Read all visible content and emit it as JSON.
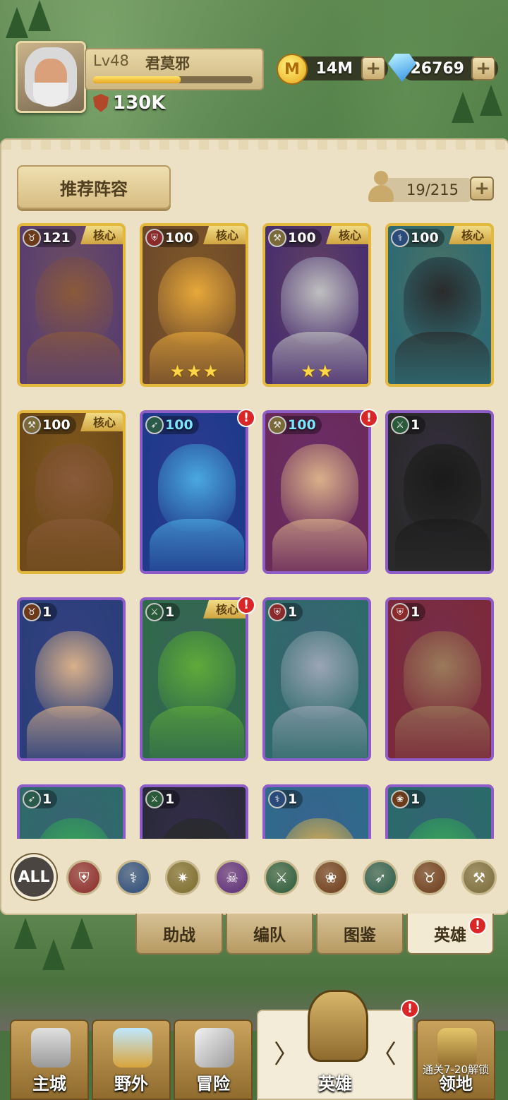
{
  "player": {
    "level": "Lv48",
    "name": "君莫邪",
    "xp_fraction": 0.55,
    "power": "130K"
  },
  "resources": {
    "gold": "14M",
    "gold_icon_glyph": "M",
    "gems": "26769"
  },
  "panel": {
    "recommend_button": "推荐阵容",
    "hero_count": "19/215"
  },
  "core_label": "核心",
  "heroes": [
    {
      "level": "121",
      "role": "ox-skull-icon",
      "core": true,
      "alert": false,
      "frame": "gold",
      "stars": 0
    },
    {
      "level": "100",
      "role": "shield-icon",
      "core": true,
      "alert": false,
      "frame": "gold",
      "stars": 3
    },
    {
      "level": "100",
      "role": "war-axe-icon",
      "core": true,
      "alert": false,
      "frame": "gold",
      "stars": 2
    },
    {
      "level": "100",
      "role": "staff-icon",
      "core": true,
      "alert": false,
      "frame": "gold",
      "stars": 0
    },
    {
      "level": "100",
      "role": "war-axe-icon",
      "core": true,
      "alert": false,
      "frame": "gold",
      "stars": 0
    },
    {
      "level": "100",
      "role": "bow-icon",
      "core": false,
      "alert": true,
      "frame": "purple",
      "stars": 0
    },
    {
      "level": "100",
      "role": "war-axe-icon",
      "core": false,
      "alert": true,
      "frame": "purple",
      "stars": 0
    },
    {
      "level": "1",
      "role": "crossed-blades-icon",
      "core": false,
      "alert": false,
      "frame": "purple",
      "stars": 0
    },
    {
      "level": "1",
      "role": "ox-skull-icon",
      "core": false,
      "alert": false,
      "frame": "purple",
      "stars": 0
    },
    {
      "level": "1",
      "role": "crossed-blades-icon",
      "core": true,
      "alert": true,
      "frame": "purple",
      "stars": 0
    },
    {
      "level": "1",
      "role": "shield-icon",
      "core": false,
      "alert": false,
      "frame": "purple",
      "stars": 0
    },
    {
      "level": "1",
      "role": "shield-icon",
      "core": false,
      "alert": false,
      "frame": "purple",
      "stars": 0
    },
    {
      "level": "1",
      "role": "bow-icon",
      "core": false,
      "alert": false,
      "frame": "purple",
      "stars": 0
    },
    {
      "level": "1",
      "role": "crossed-blades-icon",
      "core": false,
      "alert": false,
      "frame": "purple",
      "stars": 0
    },
    {
      "level": "1",
      "role": "staff-icon",
      "core": false,
      "alert": false,
      "frame": "purple",
      "stars": 0
    },
    {
      "level": "1",
      "role": "paw-icon",
      "core": false,
      "alert": false,
      "frame": "purple",
      "stars": 0
    }
  ],
  "filters": {
    "all_label": "ALL",
    "icons": [
      "shield-icon",
      "staff-icon",
      "holy-emblem-icon",
      "skull-icon",
      "crossed-blades-icon",
      "paw-icon",
      "bow-icon",
      "ox-skull-icon",
      "war-axe-icon"
    ]
  },
  "tabs": [
    {
      "label": "助战",
      "active": false,
      "alert": false
    },
    {
      "label": "编队",
      "active": false,
      "alert": false
    },
    {
      "label": "图鉴",
      "active": false,
      "alert": false
    },
    {
      "label": "英雄",
      "active": true,
      "alert": true
    }
  ],
  "nav": {
    "city": "主城",
    "wild": "野外",
    "adventure": "冒险",
    "hero": "英雄",
    "territory": "领地",
    "territory_lock": "通关7-20解锁"
  },
  "alert_glyph": "!",
  "colors": {
    "gold_frame": "#e2b93c",
    "purple_frame": "#8d5cc9",
    "alert_red": "#d92626",
    "panel_bg": "#ece1c4"
  }
}
